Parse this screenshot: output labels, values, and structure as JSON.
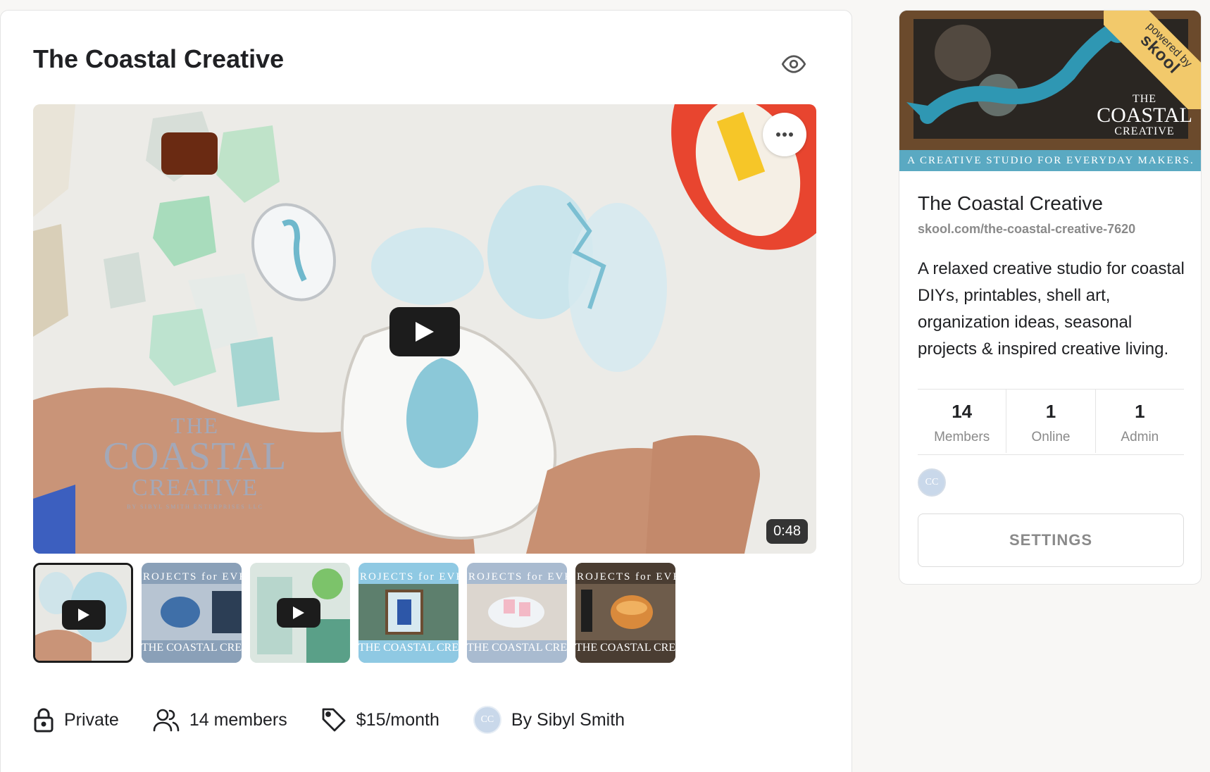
{
  "main": {
    "title": "The Coastal Creative",
    "video": {
      "duration": "0:48",
      "watermark": {
        "line1": "THE",
        "line2": "COASTAL",
        "line3": "CREATIVE",
        "line4": "BY SIBYL SMITH ENTERPRISES LLC"
      }
    },
    "thumbnails": [
      {
        "kind": "video",
        "top_text": "",
        "bottom_text": "",
        "bg": "#dfe3e6"
      },
      {
        "kind": "image",
        "top_text": "ROJECTS for EVER",
        "bottom_text": "THE COASTAL CRE",
        "bg": "#8aa0b8"
      },
      {
        "kind": "video",
        "top_text": "",
        "bottom_text": "",
        "bg": "#cfe0d8"
      },
      {
        "kind": "image",
        "top_text": "ROJECTS for EVER",
        "bottom_text": "THE COASTAL CRE",
        "bg": "#8fc9e3"
      },
      {
        "kind": "image",
        "top_text": "ROJECTS for EVER",
        "bottom_text": "THE COASTAL CRE",
        "bg": "#a9bbd0"
      },
      {
        "kind": "image",
        "top_text": "ROJECTS for EVER",
        "bottom_text": "THE COASTAL CRE",
        "bg": "#4a3d32"
      }
    ],
    "meta": {
      "privacy": "Private",
      "members": "14 members",
      "price": "$15/month",
      "author_initials": "CC",
      "author": "By Sibyl Smith"
    }
  },
  "sidebar": {
    "banner": {
      "ribbon_small": "powered by",
      "ribbon_brand": "skool",
      "logo_line1": "THE",
      "logo_line2": "COASTAL",
      "logo_line3": "CREATIVE",
      "strip": "A CREATIVE STUDIO FOR EVERYDAY MAKERS."
    },
    "name": "The Coastal Creative",
    "url": "skool.com/the-coastal-creative-7620",
    "description": "A relaxed creative studio for coastal DIYs, printables, shell art, organization ideas, seasonal projects & inspired creative living.",
    "stats": [
      {
        "value": "14",
        "label": "Members"
      },
      {
        "value": "1",
        "label": "Online"
      },
      {
        "value": "1",
        "label": "Admin"
      }
    ],
    "admin_initials": "CC",
    "settings_label": "SETTINGS"
  },
  "colors": {
    "accent_ribbon": "#f2c96b",
    "banner_strip": "#5aa9c2",
    "muted_text": "#8a8a8a"
  }
}
